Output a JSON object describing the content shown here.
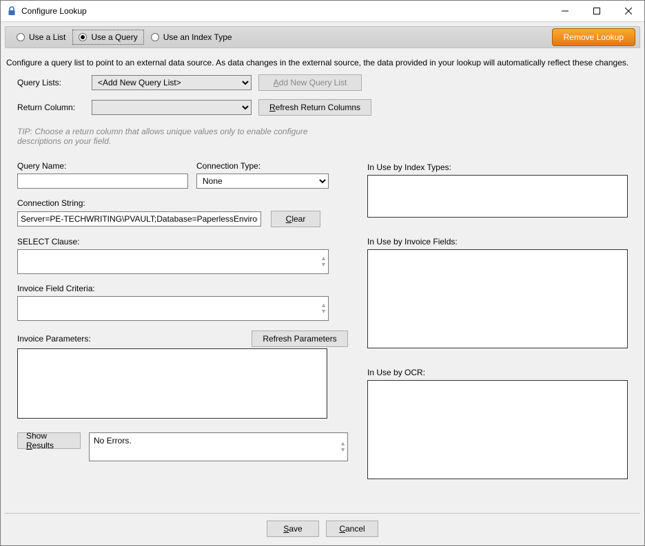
{
  "window": {
    "title": "Configure Lookup"
  },
  "ribbon": {
    "options": {
      "use_list": "Use a List",
      "use_query": "Use a Query",
      "use_index": "Use an Index Type"
    },
    "selected": "use_query",
    "remove_label": "Remove Lookup"
  },
  "description": "Configure a query list to point to an external data source. As data changes in the external source, the data provided in your lookup will automatically reflect these changes.",
  "query_lists": {
    "label": "Query Lists:",
    "value": "<Add New Query List>",
    "add_btn": "Add New Query List"
  },
  "return_column": {
    "label": "Return Column:",
    "value": "",
    "refresh_btn": "Refresh Return Columns"
  },
  "tip": "TIP: Choose a return column that allows unique values only to enable configure descriptions on your field.",
  "query_name": {
    "label": "Query Name:",
    "value": ""
  },
  "connection_type": {
    "label": "Connection Type:",
    "value": "None"
  },
  "connection_string": {
    "label": "Connection String:",
    "value": "Server=PE-TECHWRITING\\PVAULT;Database=PaperlessEnvironmen",
    "clear_btn": "Clear"
  },
  "select_clause": {
    "label": "SELECT Clause:",
    "value": ""
  },
  "invoice_criteria": {
    "label": "Invoice Field Criteria:",
    "value": ""
  },
  "invoice_params": {
    "label": "Invoice Parameters:",
    "refresh_btn": "Refresh Parameters",
    "value": ""
  },
  "show_results": {
    "btn": "Show Results",
    "status": "No Errors."
  },
  "right": {
    "index_types": {
      "label": "In Use by Index Types:"
    },
    "invoice_fields": {
      "label": "In Use by Invoice Fields:"
    },
    "ocr": {
      "label": "In Use by OCR:"
    }
  },
  "footer": {
    "save": "Save",
    "cancel": "Cancel"
  }
}
